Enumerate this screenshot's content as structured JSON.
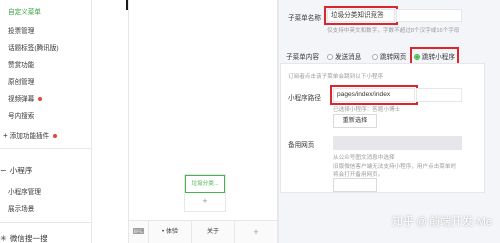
{
  "sidebar": {
    "items": [
      {
        "label": "自定义菜单",
        "active": true
      },
      {
        "label": "投票管理"
      },
      {
        "label": "话题标签(腾讯版)"
      },
      {
        "label": "赞赏功能"
      },
      {
        "label": "原创管理"
      },
      {
        "label": "视频弹幕",
        "dot": true
      },
      {
        "label": "号内搜索"
      }
    ],
    "add_plugin": {
      "label": "添加功能插件",
      "dot": true
    },
    "sections": [
      {
        "icon": "mini-program-icon",
        "icon_glyph": "∽",
        "title": "小程序",
        "items": [
          "小程序管理",
          "展示场景"
        ]
      },
      {
        "icon": "wechat-search-icon",
        "icon_glyph": "✳",
        "title": "微信搜一搜"
      }
    ]
  },
  "preview": {
    "submenu_label": "垃圾分类...",
    "submenu_add": "+",
    "menu_bar": [
      "体验",
      "关于",
      "+"
    ],
    "menu_dot": "•",
    "keyboard_icon": "⌨"
  },
  "panel": {
    "submenu_name_label": "子菜单名称",
    "submenu_name_value": "垃圾分类知识竞答",
    "submenu_name_tip": "仅支持中英文和数字，字数不超过8个汉字或16个字母",
    "content_label": "子菜单内容",
    "content_options": [
      {
        "label": "发送消息",
        "checked": false
      },
      {
        "label": "跳转网页",
        "checked": false
      },
      {
        "label": "跳转小程序",
        "checked": true
      }
    ],
    "box_tip": "订阅者点击该子菜单会跳到以下小程序",
    "path_label": "小程序路径",
    "path_value": "pages/index/index",
    "path_tip": "已选择小程序：答题小博士",
    "reselect_button": "重新选择",
    "backup_label": "备用网页",
    "backup_tip1": "从公众号图文消息中选择",
    "backup_tip2": "旧版微信客户端无法支持小程序，用户点击菜单时",
    "backup_tip3": "将会打开备用网页。"
  },
  "watermark": {
    "brand": "知乎",
    "at": "@",
    "author": "前端开发-Me"
  },
  "colors": {
    "accent": "#44b549",
    "highlight": "#d9282d",
    "panel_bg": "#f4f5f9"
  }
}
